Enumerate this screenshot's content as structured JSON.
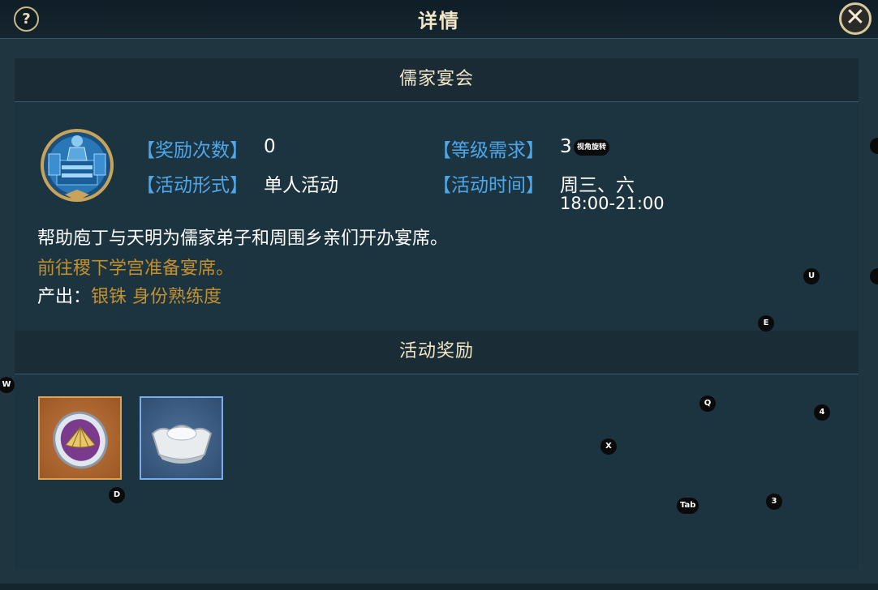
{
  "header": {
    "title": "详情",
    "help_label": "?",
    "close_label": "✕"
  },
  "activity": {
    "name": "儒家宴会",
    "icon": "confucian-banquet-icon",
    "rewards_count_label": "【奖励次数】",
    "rewards_count_value": "0",
    "level_req_label": "【等级需求】",
    "level_req_value": "3",
    "form_label": "【活动形式】",
    "form_value": "单人活动",
    "time_label": "【活动时间】",
    "time_days": "周三、六",
    "time_hours": "18:00-21:00",
    "description": "帮助庖丁与天明为儒家弟子和周围乡亲们开办宴席。",
    "objective": "前往稷下学宫准备宴席。",
    "output_label": "产出：",
    "output_value": "银铢 身份熟练度"
  },
  "rewards": {
    "title": "活动奖励",
    "items": [
      {
        "icon": "fan-token-icon",
        "rarity_color": "#e0a055"
      },
      {
        "icon": "silver-ingot-icon",
        "rarity_color": "#7aaee6"
      }
    ]
  },
  "overlay_hints": {
    "camera_rotate": "视角旋转",
    "keys": [
      "U",
      "E",
      "W",
      "Q",
      "4",
      "X",
      "D",
      "Tab",
      "3"
    ]
  },
  "colors": {
    "label_blue": "#4fa7e8",
    "gold_text": "#c2902e",
    "header_text": "#f1e6c5"
  }
}
